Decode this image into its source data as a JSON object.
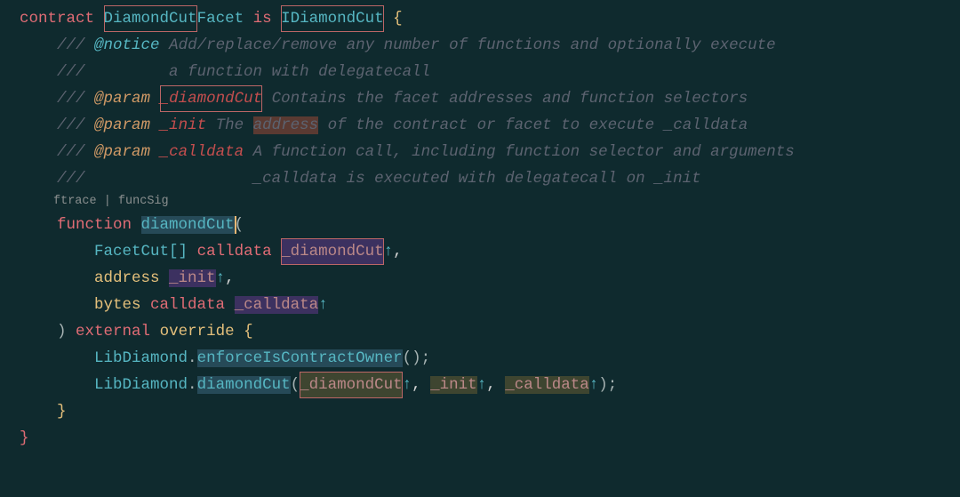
{
  "l1": {
    "kw1": "contract",
    "sp": " ",
    "name1": "DiamondCut",
    "name2": "Facet",
    "kw2": "is",
    "iface": "IDiamondCut",
    "brace": "{"
  },
  "c1": {
    "slashes": "///",
    "tag": "@notice",
    "text": " Add/replace/remove any number of functions and optionally execute"
  },
  "c2": {
    "slashes": "///",
    "text": "         a function with delegatecall"
  },
  "c3": {
    "slashes": "///",
    "tag": "@param",
    "name": "_diamondCut",
    "text": " Contains the facet addresses and function selectors"
  },
  "c4": {
    "slashes": "///",
    "tag": "@param",
    "name": "_init",
    "text": " The ",
    "hl": "address",
    "text2": " of the contract or facet to execute _calldata"
  },
  "c5": {
    "slashes": "///",
    "tag": "@param",
    "name": "_calldata",
    "text": " A function call, including function selector and arguments"
  },
  "c6": {
    "slashes": "///",
    "text": "                  _calldata is executed with delegatecall on _init"
  },
  "lens": {
    "a": "ftrace",
    "sep": " | ",
    "b": "funcSig"
  },
  "fn": {
    "kw": "function",
    "name": "diamondCut",
    "open": "(",
    "p1_type": "FacetCut[]",
    "p1_kw": "calldata",
    "p1_name": "_diamondCut",
    "p1_arrow": "↑",
    "comma": ",",
    "p2_type": "address",
    "p2_name": "_init",
    "p2_arrow": "↑",
    "p3_type": "bytes",
    "p3_kw": "calldata",
    "p3_name": "_calldata",
    "p3_arrow": "↑",
    "close": ")",
    "ext": "external",
    "ovr": "override",
    "brace": "{"
  },
  "b1": {
    "obj": "LibDiamond",
    "dot": ".",
    "fn": "enforceIsContractOwner",
    "args": "();"
  },
  "b2": {
    "obj": "LibDiamond",
    "dot": ".",
    "fn": "diamondCut",
    "open": "(",
    "a1": "_diamondCut",
    "ar1": "↑",
    "c": ", ",
    "a2": "_init",
    "ar2": "↑",
    "a3": "_calldata",
    "ar3": "↑",
    "close": ");"
  },
  "end": {
    "b1": "}",
    "b2": "}"
  }
}
